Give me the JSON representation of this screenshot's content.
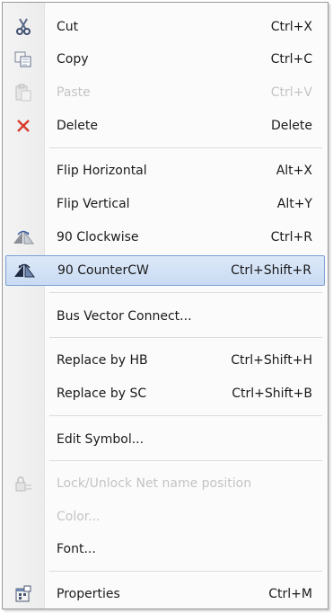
{
  "menu": {
    "items": [
      {
        "label": "Cut",
        "shortcut": "Ctrl+X",
        "icon": "scissors-icon",
        "enabled": true
      },
      {
        "label": "Copy",
        "shortcut": "Ctrl+C",
        "icon": "copy-icon",
        "enabled": true
      },
      {
        "label": "Paste",
        "shortcut": "Ctrl+V",
        "icon": "paste-icon",
        "enabled": false
      },
      {
        "label": "Delete",
        "shortcut": "Delete",
        "icon": "delete-x-icon",
        "enabled": true
      },
      {
        "label": "Flip Horizontal",
        "shortcut": "Alt+X",
        "enabled": true
      },
      {
        "label": "Flip Vertical",
        "shortcut": "Alt+Y",
        "enabled": true
      },
      {
        "label": "90 Clockwise",
        "shortcut": "Ctrl+R",
        "icon": "rotate-clockwise-icon",
        "enabled": true
      },
      {
        "label": "90 CounterCW",
        "shortcut": "Ctrl+Shift+R",
        "icon": "rotate-counterclockwise-icon",
        "enabled": true,
        "highlighted": true
      },
      {
        "label": "Bus Vector Connect...",
        "shortcut": "",
        "enabled": true
      },
      {
        "label": "Replace by HB",
        "shortcut": "Ctrl+Shift+H",
        "enabled": true
      },
      {
        "label": "Replace by SC",
        "shortcut": "Ctrl+Shift+B",
        "enabled": true
      },
      {
        "label": "Edit Symbol...",
        "shortcut": "",
        "enabled": true
      },
      {
        "label": "Lock/Unlock Net name position",
        "shortcut": "",
        "icon": "lock-net-name-icon",
        "enabled": false
      },
      {
        "label": "Color...",
        "shortcut": "",
        "enabled": false
      },
      {
        "label": "Font...",
        "shortcut": "",
        "enabled": true
      },
      {
        "label": "Properties",
        "shortcut": "Ctrl+M",
        "icon": "properties-icon",
        "enabled": true
      }
    ]
  },
  "colors": {
    "highlight_fill": "#c9dbf3",
    "highlight_border": "#7b9fd3",
    "delete_icon": "#d83b2b",
    "disabled_text": "#c4c4c4"
  }
}
